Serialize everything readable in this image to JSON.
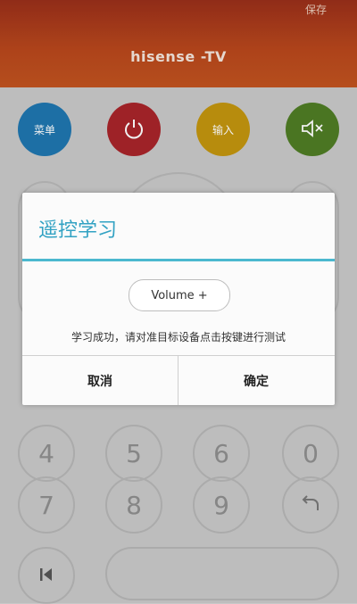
{
  "header": {
    "save_label": "保存",
    "title": "hisense -TV"
  },
  "remote": {
    "buttons": {
      "menu": "菜单",
      "input": "输入"
    },
    "keypad": [
      "4",
      "5",
      "6",
      "0",
      "7",
      "8",
      "9"
    ]
  },
  "dialog": {
    "title": "遥控学习",
    "key_name": "Volume +",
    "message": "学习成功，请对准目标设备点击按键进行测试",
    "cancel_label": "取消",
    "ok_label": "确定"
  }
}
